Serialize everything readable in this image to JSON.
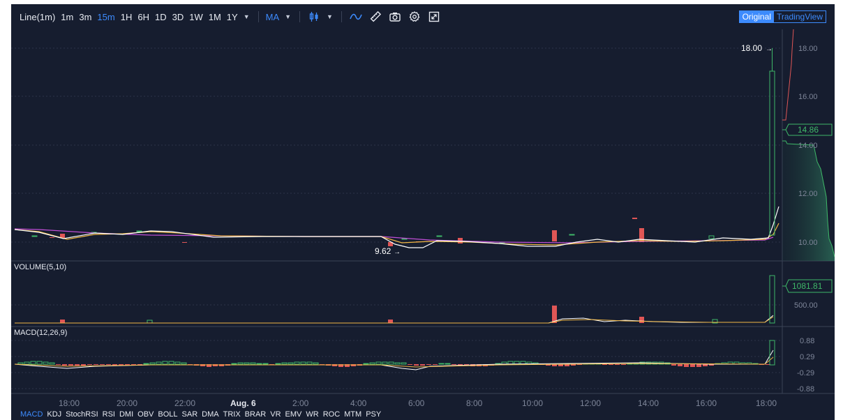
{
  "toolbar": {
    "chart_type": "Line(1m)",
    "intervals": [
      {
        "label": "1m",
        "active": false
      },
      {
        "label": "3m",
        "active": false
      },
      {
        "label": "15m",
        "active": true
      },
      {
        "label": "1H",
        "active": false
      },
      {
        "label": "6H",
        "active": false
      },
      {
        "label": "1D",
        "active": false
      },
      {
        "label": "3D",
        "active": false
      },
      {
        "label": "1W",
        "active": false
      },
      {
        "label": "1M",
        "active": false
      },
      {
        "label": "1Y",
        "active": false
      }
    ],
    "ma_label": "MA",
    "icons": [
      "candlestick-icon",
      "line-tool-icon",
      "ruler-icon",
      "camera-icon",
      "gear-icon",
      "fullscreen-icon"
    ],
    "view_original": "Original",
    "view_tradingview": "TradingView"
  },
  "colors": {
    "background": "#161d2f",
    "grid": "#2c3448",
    "up": "#3fb868",
    "down": "#e05656",
    "white_line": "#ffffff",
    "yellow_line": "#f2b844",
    "purple_line": "#c04ed6",
    "accent": "#3d8bfd"
  },
  "main_panel": {
    "price_axis": [
      "18.00",
      "16.00",
      "14.00",
      "12.00",
      "10.00"
    ],
    "last_price": "14.86",
    "high_marker": "18.00",
    "low_marker": "9.62"
  },
  "volume_panel": {
    "title": "VOLUME(5,10)",
    "axis": [
      "500.00"
    ],
    "last_value": "1081.81"
  },
  "macd_panel": {
    "title": "MACD(12,26,9)",
    "axis": [
      "0.88",
      "0.29",
      "-0.29",
      "-0.88"
    ]
  },
  "time_axis": [
    "18:00",
    "20:00",
    "22:00",
    "Aug. 6",
    "2:00",
    "4:00",
    "6:00",
    "8:00",
    "10:00",
    "12:00",
    "14:00",
    "16:00",
    "18:00"
  ],
  "indicators": [
    {
      "label": "MACD",
      "active": true
    },
    {
      "label": "KDJ",
      "active": false
    },
    {
      "label": "StochRSI",
      "active": false
    },
    {
      "label": "RSI",
      "active": false
    },
    {
      "label": "DMI",
      "active": false
    },
    {
      "label": "OBV",
      "active": false
    },
    {
      "label": "BOLL",
      "active": false
    },
    {
      "label": "SAR",
      "active": false
    },
    {
      "label": "DMA",
      "active": false
    },
    {
      "label": "TRIX",
      "active": false
    },
    {
      "label": "BRAR",
      "active": false
    },
    {
      "label": "VR",
      "active": false
    },
    {
      "label": "EMV",
      "active": false
    },
    {
      "label": "WR",
      "active": false
    },
    {
      "label": "ROC",
      "active": false
    },
    {
      "label": "MTM",
      "active": false
    },
    {
      "label": "PSY",
      "active": false
    }
  ],
  "chart_data": {
    "type": "candlestick",
    "x": [
      "18:00",
      "20:00",
      "22:00",
      "Aug. 6",
      "2:00",
      "4:00",
      "6:00",
      "8:00",
      "10:00",
      "12:00",
      "14:00",
      "16:00",
      "18:00"
    ],
    "price_ylim": [
      9.6,
      18.2
    ],
    "price_close": [
      10.5,
      10.25,
      10.45,
      10.35,
      10.35,
      10.35,
      10.35,
      9.95,
      10.2,
      10.0,
      10.1,
      10.05,
      10.05,
      10.15,
      10.4,
      11.6
    ],
    "price_ma": [
      10.5,
      10.35,
      10.4,
      10.35,
      10.35,
      10.35,
      10.35,
      10.1,
      10.15,
      10.05,
      10.05,
      10.1,
      10.1,
      10.15,
      10.2,
      10.8
    ],
    "price_ma_long": [
      10.5,
      10.45,
      10.4,
      10.4,
      10.35,
      10.35,
      10.35,
      10.3,
      10.2,
      10.15,
      10.1,
      10.1,
      10.15,
      10.15,
      10.15,
      10.3
    ],
    "final_candle": {
      "open": 10.4,
      "high": 18.0,
      "low": 10.4,
      "close": 18.0
    },
    "depth_levels": [
      18.0,
      16.0,
      14.86,
      14.0,
      12.0,
      10.0
    ],
    "volume_ylim": [
      0,
      1081.81
    ],
    "macd_ylim": [
      -0.88,
      0.88
    ],
    "macd_last": 0.88
  }
}
